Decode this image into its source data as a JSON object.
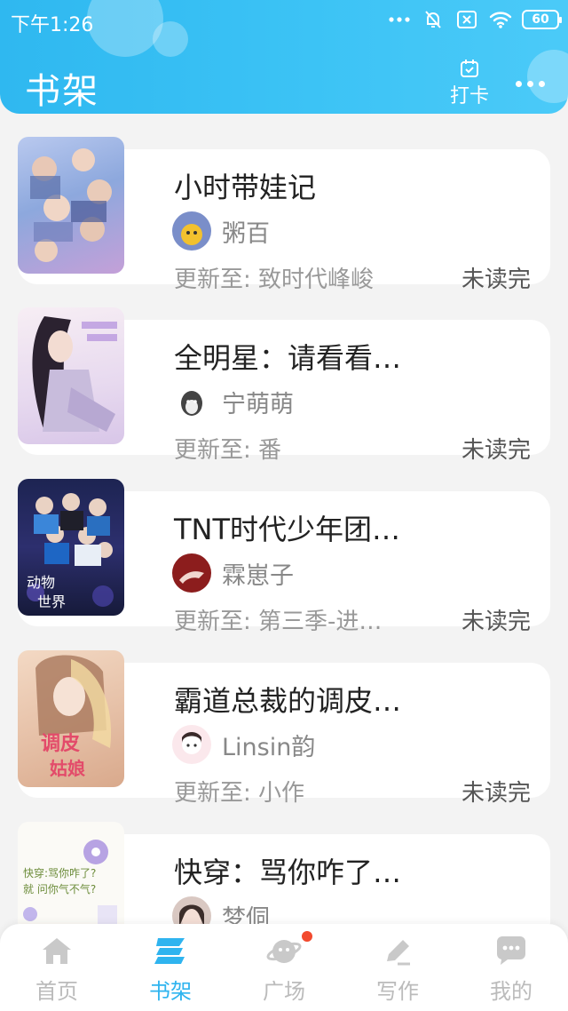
{
  "status_bar": {
    "time": "下午1:26",
    "battery": "60",
    "icons": [
      "more-dots-icon",
      "mute-bell-icon",
      "sim-off-icon",
      "wifi-icon",
      "battery-icon"
    ]
  },
  "header": {
    "title": "书架",
    "checkin_label": "打卡",
    "more_icon": "more-horizontal-icon"
  },
  "books": [
    {
      "title": "小时带娃记",
      "author": "粥百",
      "update_prefix": "更新至:",
      "update": "致时代峰峻",
      "status": "未读完"
    },
    {
      "title": "全明星：请看看…",
      "author": "宁萌萌",
      "update_prefix": "更新至:",
      "update": "番",
      "status": "未读完"
    },
    {
      "title": "TNT时代少年团…",
      "author": "霖崽子",
      "update_prefix": "更新至:",
      "update": "第三季-进…",
      "status": "未读完"
    },
    {
      "title": "霸道总裁的调皮…",
      "author": "Linsin韵",
      "update_prefix": "更新至:",
      "update": "小作",
      "status": "未读完"
    },
    {
      "title": "快穿：骂你咋了…",
      "author": "梦侗",
      "update_prefix": "",
      "update": "",
      "status": ""
    }
  ],
  "nav": [
    {
      "label": "首页",
      "icon": "home-icon"
    },
    {
      "label": "书架",
      "icon": "bookshelf-icon"
    },
    {
      "label": "广场",
      "icon": "planet-icon"
    },
    {
      "label": "写作",
      "icon": "pen-icon"
    },
    {
      "label": "我的",
      "icon": "chat-bubble-icon"
    }
  ],
  "colors": {
    "header_gradient_start": "#2fb8f0",
    "header_gradient_end": "#4bcaf8",
    "active_nav": "#2fb4ef",
    "inactive_nav": "#bbbbbb",
    "badge_red": "#f24a2e"
  }
}
